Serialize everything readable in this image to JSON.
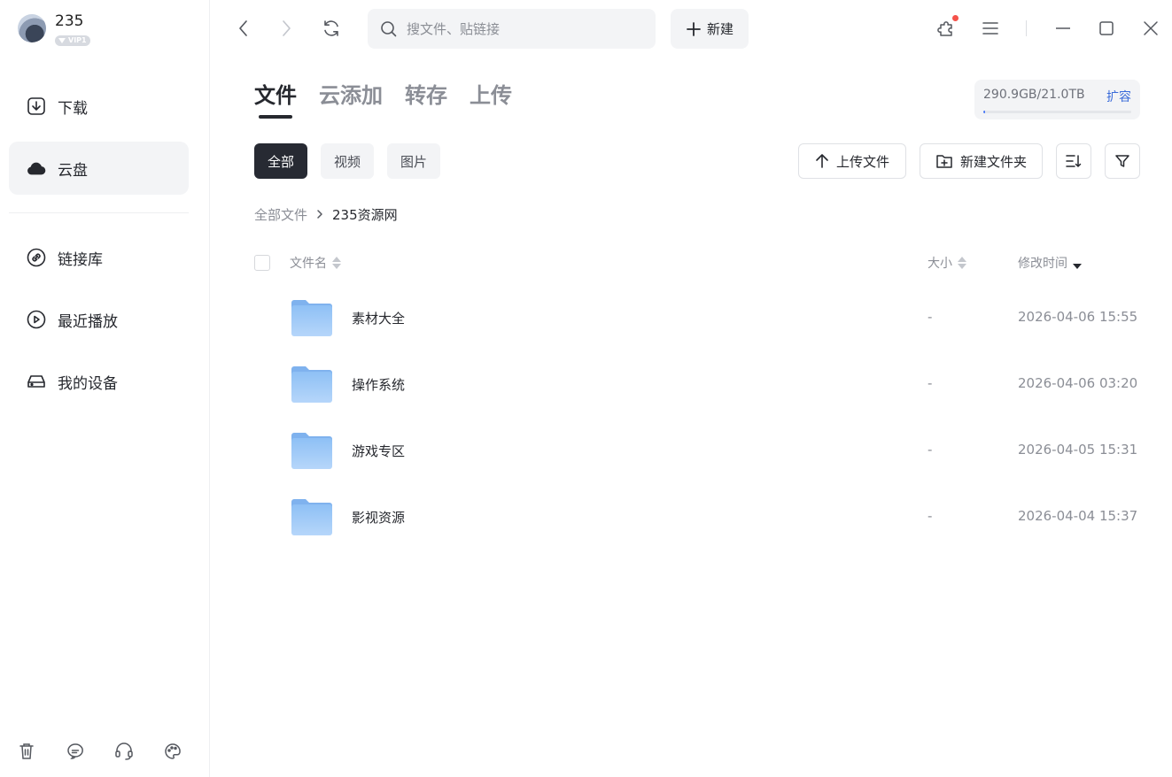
{
  "user": {
    "name": "235",
    "vip": "VIP1"
  },
  "sidebar": {
    "items": [
      {
        "label": "下载",
        "icon": "download-icon"
      },
      {
        "label": "云盘",
        "icon": "cloud-icon",
        "active": true
      },
      {
        "label": "链接库",
        "icon": "link-icon"
      },
      {
        "label": "最近播放",
        "icon": "play-icon"
      },
      {
        "label": "我的设备",
        "icon": "device-icon"
      }
    ],
    "bottom_icons": [
      "trash-icon",
      "chat-icon",
      "headset-icon",
      "palette-icon"
    ]
  },
  "toolbar": {
    "search_placeholder": "搜文件、贴链接",
    "new_label": "新建"
  },
  "tabs": [
    {
      "label": "文件",
      "active": true
    },
    {
      "label": "云添加"
    },
    {
      "label": "转存"
    },
    {
      "label": "上传"
    }
  ],
  "storage": {
    "used": "290.9GB",
    "total": "21.0TB",
    "separator": "/",
    "expand_label": "扩容",
    "fraction": 0.0135
  },
  "filters": [
    {
      "label": "全部",
      "active": true
    },
    {
      "label": "视频"
    },
    {
      "label": "图片"
    }
  ],
  "actions": {
    "upload_label": "上传文件",
    "new_folder_label": "新建文件夹"
  },
  "breadcrumb": {
    "root": "全部文件",
    "current": "235资源网"
  },
  "table": {
    "columns": {
      "name": "文件名",
      "size": "大小",
      "modified": "修改时间"
    },
    "rows": [
      {
        "name": "素材大全",
        "size": "-",
        "modified": "2026-04-06 15:55"
      },
      {
        "name": "操作系统",
        "size": "-",
        "modified": "2026-04-06 03:20"
      },
      {
        "name": "游戏专区",
        "size": "-",
        "modified": "2026-04-05 15:31"
      },
      {
        "name": "影视资源",
        "size": "-",
        "modified": "2026-04-04 15:37"
      }
    ]
  },
  "colors": {
    "accent": "#272a33",
    "link": "#3a6bd9",
    "notify": "#f5524a",
    "folder": "#8ec0f5"
  }
}
